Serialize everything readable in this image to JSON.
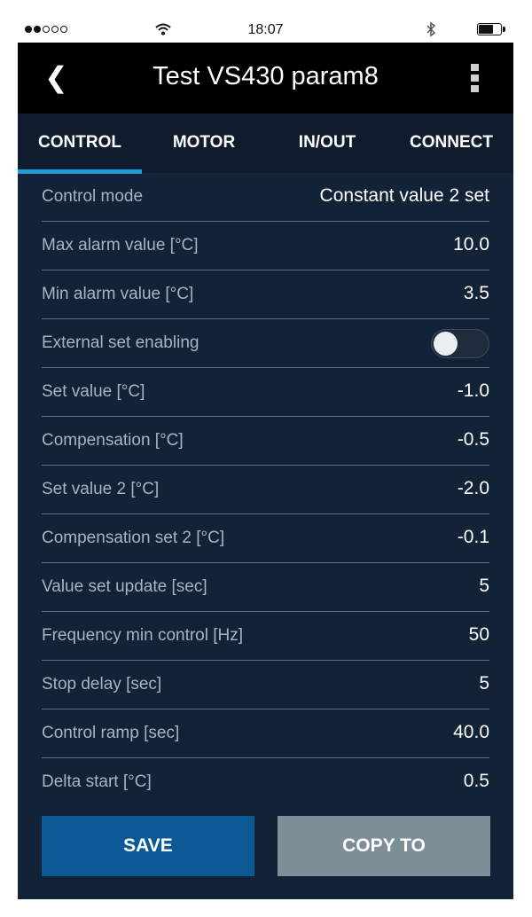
{
  "status_bar": {
    "time": "18:07",
    "signal_dots": 5,
    "signal_filled": 2,
    "icons": [
      "wifi-icon",
      "bluetooth-icon",
      "battery-icon"
    ]
  },
  "header": {
    "title": "Test VS430 param8",
    "back_icon": "chevron-left-icon",
    "menu_icon": "kebab-menu-icon"
  },
  "tabs": [
    {
      "label": "CONTROL",
      "active": true
    },
    {
      "label": "MOTOR",
      "active": false
    },
    {
      "label": "IN/OUT",
      "active": false
    },
    {
      "label": "CONNECT",
      "active": false
    }
  ],
  "params": [
    {
      "label": "Control mode",
      "value": "Constant value 2 set"
    },
    {
      "label": "Max alarm value [°C]",
      "value": "10.0"
    },
    {
      "label": "Min alarm value [°C]",
      "value": "3.5"
    },
    {
      "label": "External set enabling",
      "toggle": false
    },
    {
      "label": "Set value [°C]",
      "value": "-1.0"
    },
    {
      "label": "Compensation [°C]",
      "value": "-0.5"
    },
    {
      "label": "Set value 2 [°C]",
      "value": "-2.0"
    },
    {
      "label": "Compensation set 2 [°C]",
      "value": "-0.1"
    },
    {
      "label": "Value set update [sec]",
      "value": "5"
    },
    {
      "label": "Frequency min control [Hz]",
      "value": "50"
    },
    {
      "label": "Stop delay [sec]",
      "value": "5"
    },
    {
      "label": "Control ramp [sec]",
      "value": "40.0"
    },
    {
      "label": "Delta start [°C]",
      "value": "0.5"
    }
  ],
  "actions": {
    "save_label": "SAVE",
    "copy_label": "COPY TO"
  },
  "colors": {
    "background": "#122338",
    "header": "#000000",
    "tab_bar": "#0f1c2e",
    "tab_indicator": "#1f9ad6",
    "label_text": "#a7b4c2",
    "divider": "#5a7187",
    "save_button": "#0b5a96",
    "copy_button": "#7d8e99"
  }
}
